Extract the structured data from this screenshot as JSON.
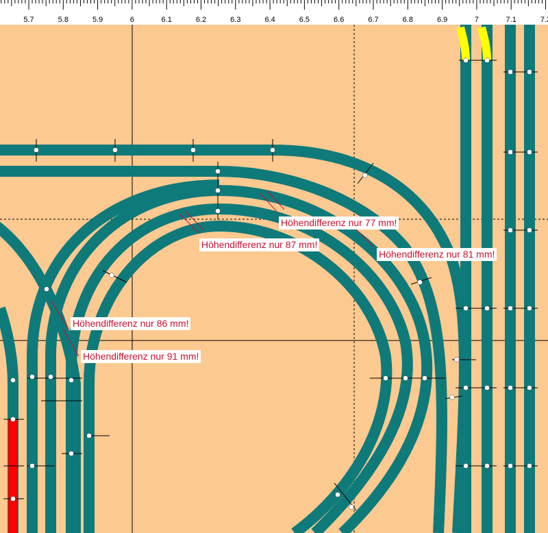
{
  "ruler": {
    "ticks": [
      "5.7",
      "5.8",
      "5.9",
      "6",
      "6.1",
      "6.2",
      "6.3",
      "6.4",
      "6.5",
      "6.6",
      "6.7",
      "6.8",
      "6.9",
      "7",
      "7.1",
      "7.2"
    ]
  },
  "colors": {
    "board": "#fcc990",
    "track": "#0f7a7a",
    "selected_track": "#ffff00",
    "highlight_track": "#ff0000",
    "warning_text": "#c8102e"
  },
  "warnings": [
    {
      "text": "Höhendifferenz nur 77 mm!"
    },
    {
      "text": "Höhendifferenz nur 87 mm!"
    },
    {
      "text": "Höhendifferenz nur 81 mm!"
    },
    {
      "text": "Höhendifferenz nur 86 mm!"
    },
    {
      "text": "Höhendifferenz nur 91 mm!"
    }
  ]
}
